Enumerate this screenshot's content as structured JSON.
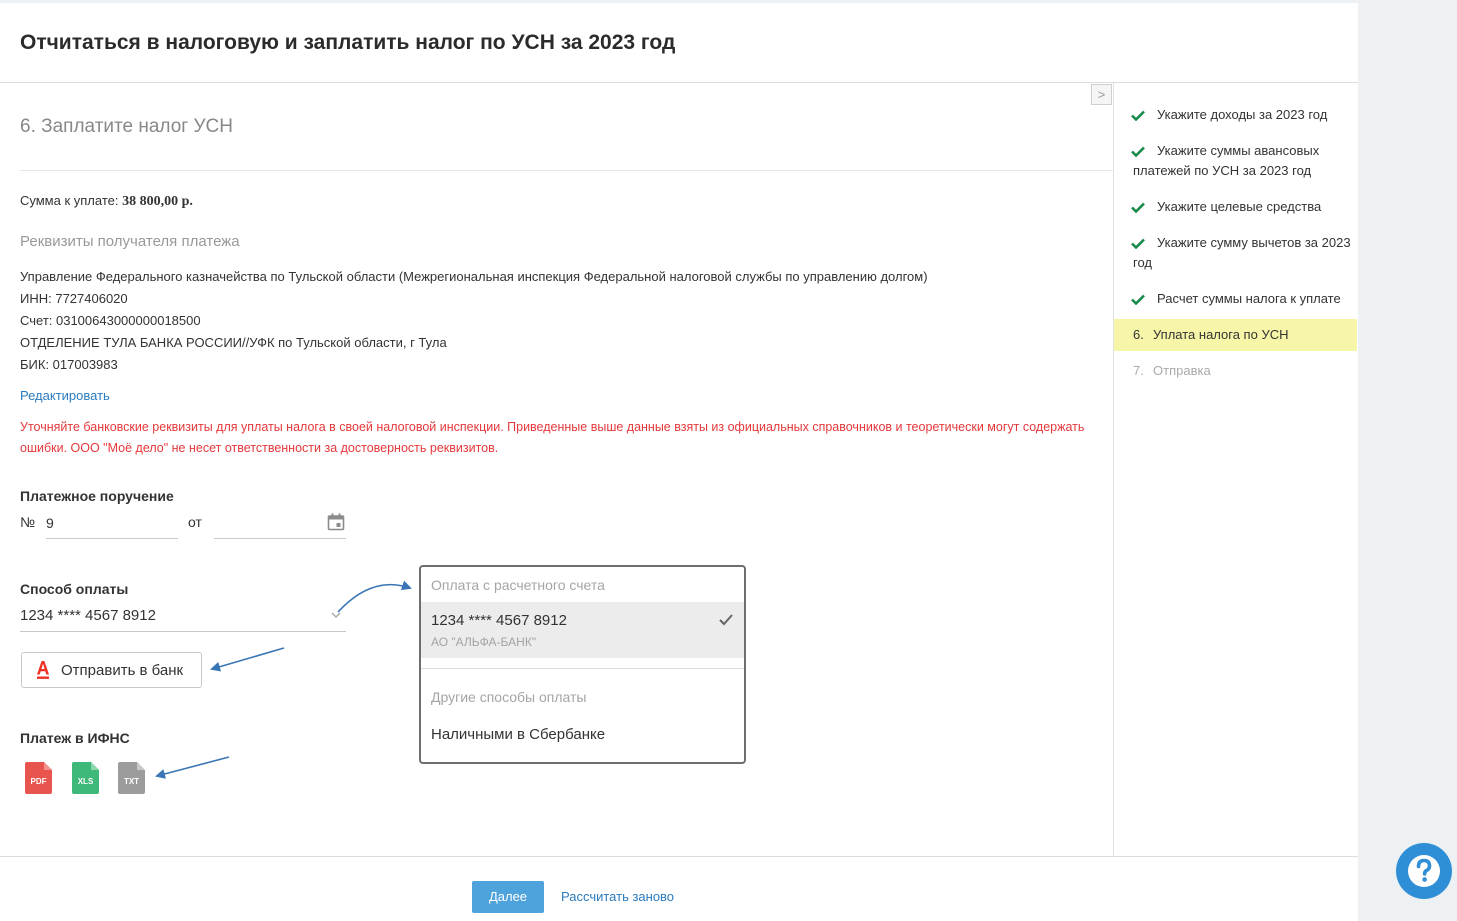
{
  "modal": {
    "title": "Отчитаться в налоговую и заплатить налог по УСН за 2023 год",
    "collapse_symbol": ">"
  },
  "step": {
    "title": "6. Заплатите налог УСН",
    "sum_label": "Сумма к уплате: ",
    "sum_value": "38 800,00 р.",
    "requisites_heading": "Реквизиты получателя платежа",
    "recipient": "Управление Федерального казначейства по Тульской области (Межрегиональная инспекция Федеральной налоговой службы по управлению долгом)",
    "inn": "ИНН: 7727406020",
    "account": "Счет: 03100643000000018500",
    "bank": "ОТДЕЛЕНИЕ ТУЛА БАНКА РОССИИ//УФК по Тульской области, г Тула",
    "bik": "БИК: 017003983",
    "edit_link": "Редактировать",
    "warning": "Уточняйте банковские реквизиты для уплаты налога в своей налоговой инспекции. Приведенные выше данные взяты из официальных справочников и теоретически могут содержать ошибки. ООО \"Моё дело\" не несет ответственности за достоверность реквизитов."
  },
  "payment_order": {
    "heading": "Платежное поручение",
    "number_sign": "№",
    "number_value": "9",
    "from_label": "от",
    "date_value": ""
  },
  "payment_method": {
    "heading": "Способ оплаты",
    "selected_value": "1234 **** 4567 8912",
    "send_button": "Отправить в банк",
    "send_button_logo_color": "#ef3124"
  },
  "ifns": {
    "heading": "Платеж в ИФНС",
    "files": [
      {
        "label": "PDF",
        "icon": "pdf-file-icon",
        "color": "#e8554e"
      },
      {
        "label": "XLS",
        "icon": "xls-file-icon",
        "color": "#3fb97a"
      },
      {
        "label": "TXT",
        "icon": "txt-file-icon",
        "color": "#9c9c9c"
      }
    ]
  },
  "dropdown": {
    "group1_label": "Оплата с расчетного счета",
    "option_selected_main": "1234 **** 4567 8912",
    "option_selected_sub": "АО \"АЛЬФА-БАНК\"",
    "group2_label": "Другие способы оплаты",
    "option_cash": "Наличными в Сбербанке"
  },
  "sidebar": {
    "items": [
      {
        "label": "Укажите доходы за 2023 год",
        "status": "done"
      },
      {
        "label": "Укажите суммы авансовых платежей по УСН за 2023 год",
        "status": "done"
      },
      {
        "label": "Укажите целевые средства",
        "status": "done"
      },
      {
        "label": "Укажите сумму вычетов за 2023 год",
        "status": "done"
      },
      {
        "label": "Расчет суммы налога к уплате",
        "status": "done"
      },
      {
        "number": "6.",
        "label": "Уплата налога по УСН",
        "status": "active"
      },
      {
        "number": "7.",
        "label": "Отправка",
        "status": "disabled"
      }
    ]
  },
  "footer": {
    "next_button": "Далее",
    "recalc_link": "Рассчитать заново"
  },
  "colors": {
    "accent": "#4fa3dc",
    "link": "#2a7bc0",
    "warning": "#e5383b",
    "check": "#1a8a4a",
    "active_step_bg": "#f6f5a8",
    "annotation_arrow": "#3a76b5"
  }
}
